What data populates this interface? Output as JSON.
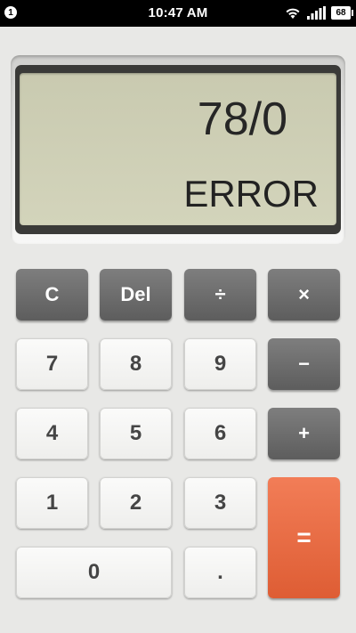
{
  "status_bar": {
    "notification_count": "1",
    "time": "10:47 AM",
    "battery_level": "68",
    "icons": [
      "wifi-icon",
      "signal-icon",
      "battery-icon"
    ]
  },
  "display": {
    "expression": "78/0",
    "result": "ERROR"
  },
  "keys": {
    "clear": "C",
    "delete": "Del",
    "divide": "÷",
    "multiply": "×",
    "seven": "7",
    "eight": "8",
    "nine": "9",
    "minus": "−",
    "four": "4",
    "five": "5",
    "six": "6",
    "plus": "+",
    "one": "1",
    "two": "2",
    "three": "3",
    "equals": "=",
    "zero": "0",
    "decimal": "."
  },
  "colors": {
    "background": "#e8e8e6",
    "lcd": "#cfd0b6",
    "operator_key": "#6e6e6e",
    "digit_key": "#f5f5f4",
    "equals_key": "#e96a43"
  }
}
